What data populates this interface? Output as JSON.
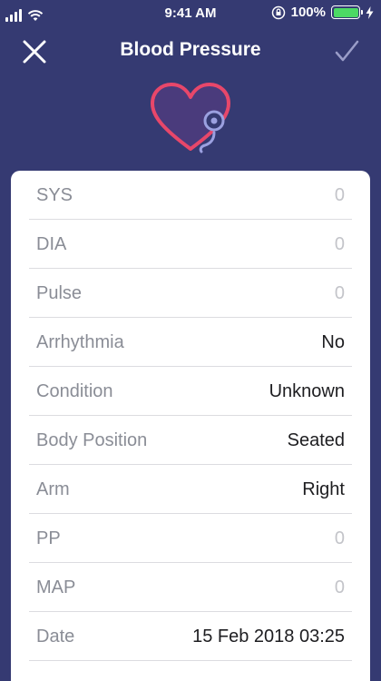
{
  "status_bar": {
    "time": "9:41 AM",
    "battery_percent": "100%",
    "battery_level": 1.0
  },
  "nav": {
    "title": "Blood Pressure",
    "close_icon": "close-icon",
    "done_icon": "checkmark-icon"
  },
  "hero": {
    "icon": "heart-stethoscope-icon"
  },
  "colors": {
    "background": "#353a72",
    "heart": "#e8476a",
    "stethoscope": "#9ba0e0",
    "label": "#8a8d96",
    "value": "#1d1d20",
    "placeholder": "#c3c4c9"
  },
  "fields": [
    {
      "label": "SYS",
      "value": "0",
      "placeholder": true
    },
    {
      "label": "DIA",
      "value": "0",
      "placeholder": true
    },
    {
      "label": "Pulse",
      "value": "0",
      "placeholder": true
    },
    {
      "label": "Arrhythmia",
      "value": "No",
      "placeholder": false
    },
    {
      "label": "Condition",
      "value": "Unknown",
      "placeholder": false
    },
    {
      "label": "Body Position",
      "value": "Seated",
      "placeholder": false
    },
    {
      "label": "Arm",
      "value": "Right",
      "placeholder": false
    },
    {
      "label": "PP",
      "value": "0",
      "placeholder": true
    },
    {
      "label": "MAP",
      "value": "0",
      "placeholder": true
    },
    {
      "label": "Date",
      "value": "15 Feb 2018 03:25",
      "placeholder": false
    }
  ]
}
